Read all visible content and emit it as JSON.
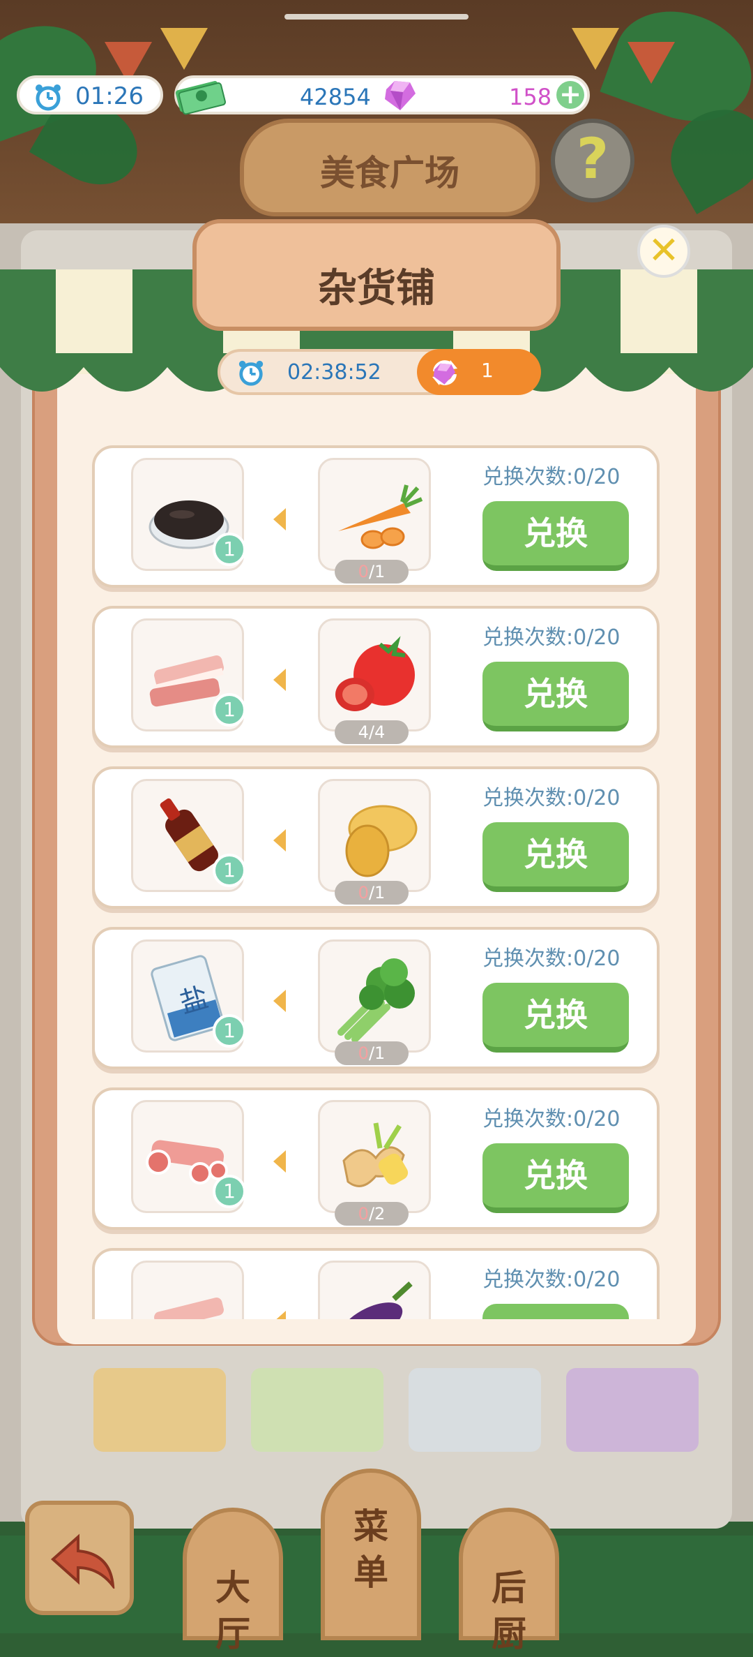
{
  "hud": {
    "timer": "01:26",
    "cash": "42854",
    "gems": "158"
  },
  "location_title": "美食广场",
  "help_symbol": "?",
  "shop": {
    "title": "杂货铺",
    "refresh_timer": "02:38:52",
    "refresh_cost": "1",
    "close_symbol": "✕",
    "items": [
      {
        "give_icon": "black-sesame-bowl-icon",
        "give_qty": "1",
        "get_icon": "carrot-icon",
        "have": "0",
        "need": "1",
        "limit": "兑换次数:0/20",
        "button": "兑换"
      },
      {
        "give_icon": "pork-belly-icon",
        "give_qty": "1",
        "get_icon": "tomato-icon",
        "have": "4",
        "need": "4",
        "limit": "兑换次数:0/20",
        "button": "兑换"
      },
      {
        "give_icon": "soy-sauce-bottle-icon",
        "give_qty": "1",
        "get_icon": "potato-icon",
        "have": "0",
        "need": "1",
        "limit": "兑换次数:0/20",
        "button": "兑换"
      },
      {
        "give_icon": "salt-bag-icon",
        "give_qty": "1",
        "get_icon": "celery-icon",
        "have": "0",
        "need": "1",
        "limit": "兑换次数:0/20",
        "button": "兑换"
      },
      {
        "give_icon": "ribs-meat-icon",
        "give_qty": "1",
        "get_icon": "ginger-icon",
        "have": "0",
        "need": "2",
        "limit": "兑换次数:0/20",
        "button": "兑换"
      },
      {
        "give_icon": "pork-belly-icon",
        "give_qty": "",
        "get_icon": "eggplant-icon",
        "have": "",
        "need": "",
        "limit": "兑换次数:0/20",
        "button": ""
      }
    ]
  },
  "salt_label": "盐",
  "nav": {
    "hall": [
      "大",
      "厅"
    ],
    "menu": [
      "菜",
      "单"
    ],
    "kitchen": [
      "后",
      "厨"
    ]
  },
  "colors": {
    "accent_green": "#7dc561",
    "modal_brown": "#d99f7e",
    "gem_purple": "#d050c8",
    "timer_blue": "#2b76b8",
    "refresh_orange": "#f28a2c"
  }
}
